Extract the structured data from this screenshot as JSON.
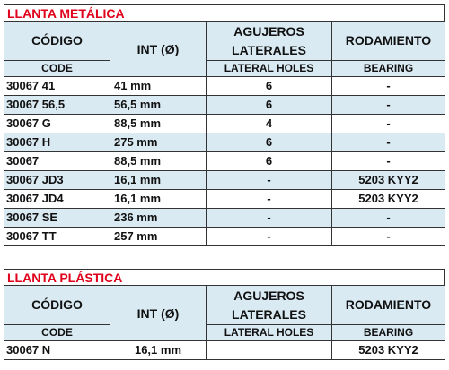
{
  "metal": {
    "title": "LLANTA METÁLICA",
    "headers": {
      "codigo": "CÓDIGO",
      "code": "CODE",
      "int": "INT (Ø)",
      "agujeros": "AGUJEROS LATERALES",
      "lateral": "LATERAL HOLES",
      "rodamiento": "RODAMIENTO",
      "bearing": "BEARING"
    },
    "rows": [
      {
        "code": "30067 41",
        "int": "41 mm",
        "holes": "6",
        "bearing": "-"
      },
      {
        "code": "30067 56,5",
        "int": "56,5 mm",
        "holes": "6",
        "bearing": "-"
      },
      {
        "code": "30067 G",
        "int": "88,5 mm",
        "holes": "4",
        "bearing": "-"
      },
      {
        "code": "30067 H",
        "int": "275 mm",
        "holes": "6",
        "bearing": "-"
      },
      {
        "code": "30067",
        "int": "88,5 mm",
        "holes": "6",
        "bearing": "-"
      },
      {
        "code": "30067 JD3",
        "int": "16,1 mm",
        "holes": "-",
        "bearing": "5203 KYY2"
      },
      {
        "code": "30067 JD4",
        "int": "16,1 mm",
        "holes": "-",
        "bearing": "5203 KYY2"
      },
      {
        "code": "30067 SE",
        "int": "236 mm",
        "holes": "-",
        "bearing": "-"
      },
      {
        "code": "30067 TT",
        "int": "257 mm",
        "holes": "-",
        "bearing": "-"
      }
    ]
  },
  "plastic": {
    "title": "LLANTA PLÁSTICA",
    "headers": {
      "codigo": "CÓDIGO",
      "code": "CODE",
      "int": "INT (Ø)",
      "agujeros": "AGUJEROS LATERALES",
      "lateral": "LATERAL HOLES",
      "rodamiento": "RODAMIENTO",
      "bearing": "BEARING"
    },
    "rows": [
      {
        "code": "30067 N",
        "int": "16,1 mm",
        "holes": "",
        "bearing": "5203 KYY2"
      }
    ]
  },
  "colors": {
    "title_red": "#e0001b",
    "header_blue": "#d9eaf3",
    "row_shade": "#daeaf3"
  }
}
